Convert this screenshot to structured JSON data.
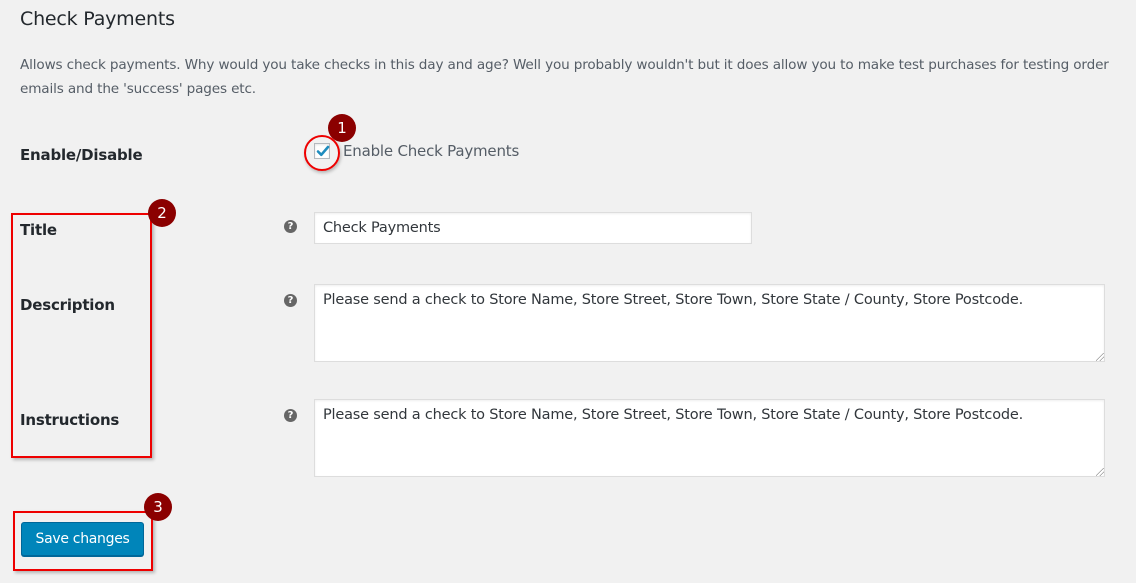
{
  "section": {
    "title": "Check Payments",
    "description": "Allows check payments. Why would you take checks in this day and age? Well you probably wouldn't but it does allow you to make test purchases for testing order emails and the 'success' pages etc."
  },
  "fields": {
    "enable": {
      "label": "Enable/Disable",
      "checkbox_label": "Enable Check Payments",
      "checked": true
    },
    "title": {
      "label": "Title",
      "help_icon": "question-circle-icon",
      "value": "Check Payments"
    },
    "description": {
      "label": "Description",
      "help_icon": "question-circle-icon",
      "value": "Please send a check to Store Name, Store Street, Store Town, Store State / County, Store Postcode."
    },
    "instructions": {
      "label": "Instructions",
      "help_icon": "question-circle-icon",
      "value": "Please send a check to Store Name, Store Street, Store Town, Store State / County, Store Postcode."
    }
  },
  "actions": {
    "save_label": "Save changes"
  },
  "annotations": {
    "badge_1": "1",
    "badge_2": "2",
    "badge_3": "3",
    "highlight_color": "#e00000",
    "badge_color": "#8b0000"
  },
  "help_glyph": "?",
  "colors": {
    "primary_button": "#0085ba",
    "background": "#f1f1f1"
  }
}
